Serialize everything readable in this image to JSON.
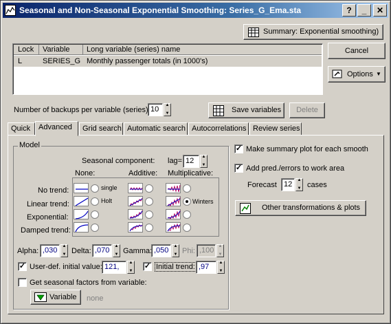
{
  "window": {
    "title": "Seasonal and Non-Seasonal Exponential Smoothing: Series_G_Ema.sta",
    "help_btn": "?",
    "min_btn": "_",
    "close_btn": "✕"
  },
  "buttons": {
    "summary": "Summary:  Exponential smoothing)",
    "cancel": "Cancel",
    "options": "Options",
    "save_variables": "Save variables",
    "delete": "Delete",
    "other_transformations": "Other transformations & plots",
    "variable": "Variable"
  },
  "variable_table": {
    "headers": [
      "Lock",
      "Variable",
      "Long variable (series) name"
    ],
    "rows": [
      {
        "lock": "L",
        "variable": "SERIES_G",
        "name": "Monthly passenger totals (in 1000's)"
      }
    ]
  },
  "backups": {
    "label": "Number of backups per variable (series):",
    "value": "10"
  },
  "tabs": [
    "Quick",
    "Advanced",
    "Grid search",
    "Automatic search",
    "Autocorrelations",
    "Review series"
  ],
  "model": {
    "group_label": "Model",
    "seasonal_label": "Seasonal component:",
    "lag_label": "lag=",
    "lag_value": "12",
    "col_none": "None:",
    "col_additive": "Additive:",
    "col_multiplicative": "Multiplicative:",
    "rows": [
      "No trend:",
      "Linear trend:",
      "Exponential:",
      "Damped trend:"
    ],
    "single_label": "single",
    "holt_label": "Holt",
    "winters_label": "Winters",
    "alpha_label": "Alpha:",
    "alpha_value": ",030",
    "delta_label": "Delta:",
    "delta_value": ",070",
    "gamma_label": "Gamma:",
    "gamma_value": ",050",
    "phi_label": "Phi:",
    "phi_value": ",100",
    "userdef_label": "User-def. initial value:",
    "userdef_value": "121,",
    "initial_trend_label": "Initial trend:",
    "initial_trend_value": ",97",
    "get_seasonal_label": "Get seasonal factors from variable:",
    "variable_none": "none"
  },
  "right_options": {
    "summary_plot": "Make summary plot for each smooth",
    "add_pred": "Add pred./errors to work area",
    "forecast_label": "Forecast",
    "forecast_value": "12",
    "cases_label": "cases"
  },
  "colors": {
    "title_start": "#0a246a",
    "title_end": "#a6caf0",
    "face": "#d4d0c8",
    "icon_line": "#0000c0",
    "icon_series": "#b00060"
  }
}
